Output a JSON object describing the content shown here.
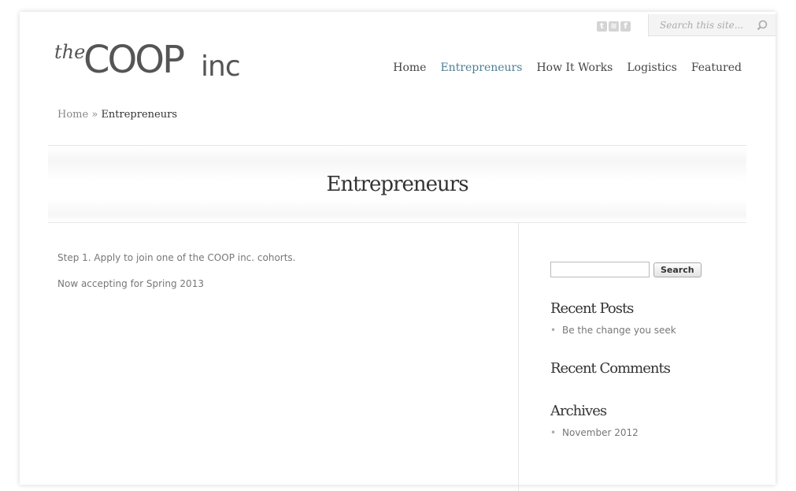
{
  "social": {
    "icons": [
      "twitter-icon",
      "rss-icon",
      "facebook-icon"
    ]
  },
  "topsearch": {
    "placeholder": "Search this site..."
  },
  "logo": {
    "the": "the",
    "coop": "COOP",
    "inc": "inc"
  },
  "nav": {
    "items": [
      "Home",
      "Entrepreneurs",
      "How It Works",
      "Logistics",
      "Featured"
    ],
    "active_color": "#4d7e92"
  },
  "breadcrumb": {
    "home": "Home",
    "separator": "»",
    "current": "Entrepreneurs"
  },
  "page": {
    "title": "Entrepreneurs"
  },
  "content": {
    "paragraphs": [
      "Step 1. Apply to join one of the COOP inc. cohorts.",
      "Now accepting for Spring 2013"
    ]
  },
  "sidebar": {
    "search_button": "Search",
    "recent_posts": {
      "title": "Recent Posts",
      "items": [
        "Be the change you seek"
      ]
    },
    "recent_comments": {
      "title": "Recent Comments"
    },
    "archives": {
      "title": "Archives",
      "items": [
        "November 2012"
      ]
    }
  }
}
